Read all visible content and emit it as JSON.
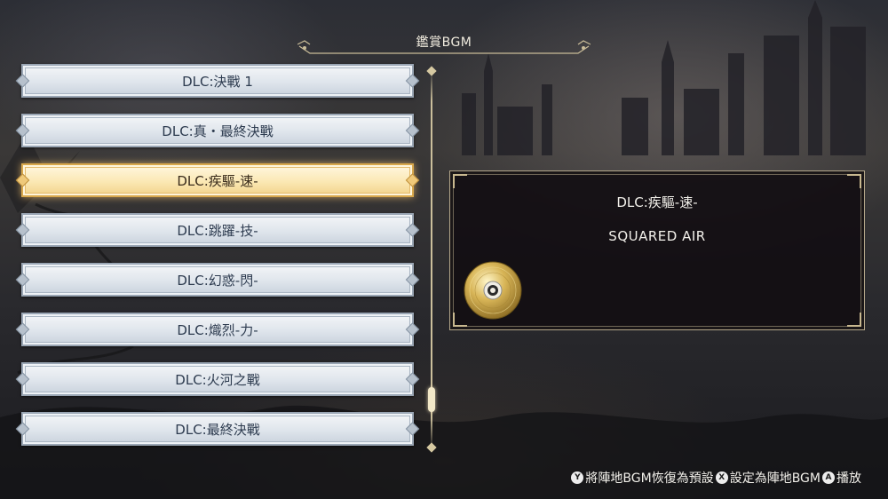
{
  "header": {
    "title": "鑑賞BGM"
  },
  "tracks": [
    {
      "label": "DLC:決戰 1"
    },
    {
      "label": "DLC:真・最終決戰"
    },
    {
      "label": "DLC:疾驅-速-"
    },
    {
      "label": "DLC:跳躍-技-"
    },
    {
      "label": "DLC:幻惑-閃-"
    },
    {
      "label": "DLC:熾烈-力-"
    },
    {
      "label": "DLC:火河之戰"
    },
    {
      "label": "DLC:最終決戰"
    }
  ],
  "selected_index": 2,
  "detail": {
    "title": "DLC:疾驅-速-",
    "artist": "SQUARED AIR",
    "disc_icon": "cd-disc-icon"
  },
  "footer": {
    "items": [
      {
        "button": "Y",
        "label": "將陣地BGM恢復為預設"
      },
      {
        "button": "X",
        "label": "設定為陣地BGM"
      },
      {
        "button": "A",
        "label": "播放"
      }
    ]
  },
  "colors": {
    "track_bg": "#dfe5ec",
    "track_text": "#2d3b4f",
    "selected_bg": "#fbe8b4",
    "panel_bg": "#120e12",
    "accent_gold": "#c8b88f"
  }
}
